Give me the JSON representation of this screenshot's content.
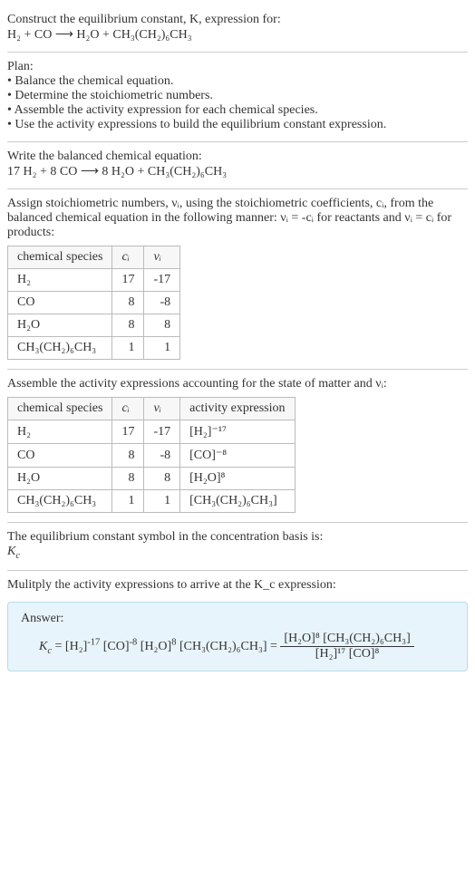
{
  "prompt": {
    "line1": "Construct the equilibrium constant, K, expression for:",
    "equation_unbalanced": "H₂ + CO ⟶ H₂O + CH₃(CH₂)₆CH₃"
  },
  "plan": {
    "heading": "Plan:",
    "items": [
      "• Balance the chemical equation.",
      "• Determine the stoichiometric numbers.",
      "• Assemble the activity expression for each chemical species.",
      "• Use the activity expressions to build the equilibrium constant expression."
    ]
  },
  "balanced": {
    "heading": "Write the balanced chemical equation:",
    "equation": "17 H₂ + 8 CO ⟶ 8 H₂O + CH₃(CH₂)₆CH₃"
  },
  "assign": {
    "text_a": "Assign stoichiometric numbers, νᵢ, using the stoichiometric coefficients, cᵢ, from the balanced chemical equation in the following manner: νᵢ = -cᵢ for reactants and νᵢ = cᵢ for products:"
  },
  "table1": {
    "headers": [
      "chemical species",
      "cᵢ",
      "νᵢ"
    ],
    "rows": [
      [
        "H₂",
        "17",
        "-17"
      ],
      [
        "CO",
        "8",
        "-8"
      ],
      [
        "H₂O",
        "8",
        "8"
      ],
      [
        "CH₃(CH₂)₆CH₃",
        "1",
        "1"
      ]
    ]
  },
  "assemble": {
    "text": "Assemble the activity expressions accounting for the state of matter and νᵢ:"
  },
  "table2": {
    "headers": [
      "chemical species",
      "cᵢ",
      "νᵢ",
      "activity expression"
    ],
    "rows": [
      {
        "sp": "H₂",
        "c": "17",
        "v": "-17",
        "a": "[H₂]⁻¹⁷"
      },
      {
        "sp": "CO",
        "c": "8",
        "v": "-8",
        "a": "[CO]⁻⁸"
      },
      {
        "sp": "H₂O",
        "c": "8",
        "v": "8",
        "a": "[H₂O]⁸"
      },
      {
        "sp": "CH₃(CH₂)₆CH₃",
        "c": "1",
        "v": "1",
        "a": "[CH₃(CH₂)₆CH₃]"
      }
    ]
  },
  "symbol": {
    "line1": "The equilibrium constant symbol in the concentration basis is:",
    "line2": "K_c"
  },
  "multiply": {
    "text": "Mulitply the activity expressions to arrive at the K_c expression:"
  },
  "answer": {
    "label": "Answer:",
    "lhs": "K_c = [H₂]⁻¹⁷ [CO]⁻⁸ [H₂O]⁸ [CH₃(CH₂)₆CH₃] =",
    "frac_num": "[H₂O]⁸ [CH₃(CH₂)₆CH₃]",
    "frac_den": "[H₂]¹⁷ [CO]⁸"
  },
  "chart_data": {
    "type": "table",
    "tables": [
      {
        "title": "Stoichiometric numbers",
        "columns": [
          "chemical species",
          "c_i",
          "ν_i"
        ],
        "rows": [
          [
            "H2",
            17,
            -17
          ],
          [
            "CO",
            8,
            -8
          ],
          [
            "H2O",
            8,
            8
          ],
          [
            "CH3(CH2)6CH3",
            1,
            1
          ]
        ]
      },
      {
        "title": "Activity expressions",
        "columns": [
          "chemical species",
          "c_i",
          "ν_i",
          "activity expression"
        ],
        "rows": [
          [
            "H2",
            17,
            -17,
            "[H2]^-17"
          ],
          [
            "CO",
            8,
            -8,
            "[CO]^-8"
          ],
          [
            "H2O",
            8,
            8,
            "[H2O]^8"
          ],
          [
            "CH3(CH2)6CH3",
            1,
            1,
            "[CH3(CH2)6CH3]"
          ]
        ]
      }
    ],
    "balanced_equation": "17 H2 + 8 CO -> 8 H2O + CH3(CH2)6CH3",
    "Kc_expression": "([H2O]^8 * [CH3(CH2)6CH3]) / ([H2]^17 * [CO]^8)"
  }
}
